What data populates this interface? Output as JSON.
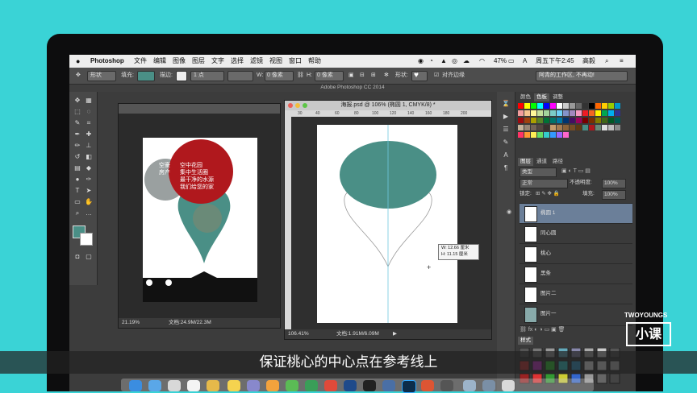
{
  "menubar": {
    "app": "Photoshop",
    "items": [
      "文件",
      "编辑",
      "图像",
      "图层",
      "文字",
      "选择",
      "滤镜",
      "视图",
      "窗口",
      "帮助"
    ],
    "battery": "47%",
    "clock": "周五下午2:45",
    "user": "高毅"
  },
  "window": {
    "title": "Adobe Photoshop CC 2014"
  },
  "options": {
    "mode": "形状",
    "fill_label": "填充:",
    "stroke_label": "描边:",
    "stroke_width": "1 点",
    "w_label": "W:",
    "w_value": "0 像素",
    "h_label": "H:",
    "h_value": "0 像素",
    "shape_label": "形状:",
    "align_edges": "对齐边缘",
    "workspace": "阿青的工作区, 不再动!",
    "colors": {
      "fill": "#4a8f86"
    }
  },
  "doc_left": {
    "title": "",
    "zoom": "21.19%",
    "size": "文档:24.9M/22.3M",
    "poster": {
      "line1a": "空豪",
      "line1b": "空中花园",
      "line2a": "房产",
      "line2b": "集中生活圈",
      "line3": "最干净的水源",
      "line4": "我们给您的家"
    }
  },
  "doc_main": {
    "title": "海报.psd @ 106% (椭圆 1, CMYK/8) *",
    "zoom": "106.41%",
    "size": "文档:1.91M/6.09M",
    "tooltip_w": "W: 12.66 厘米",
    "tooltip_h": "H: 11.15 厘米",
    "ruler": [
      "30",
      "40",
      "60",
      "80",
      "100",
      "120",
      "140",
      "160",
      "180",
      "200"
    ],
    "colors": {
      "ellipse": "#4a8f86"
    }
  },
  "panels": {
    "swatches_tabs": [
      "颜色",
      "色板",
      "调整"
    ],
    "layers_tabs": [
      "图层",
      "通道",
      "路径"
    ],
    "kind": "类型",
    "blend": "正常",
    "opacity_label": "不透明度:",
    "opacity": "100%",
    "lock_label": "锁定:",
    "fill_label": "填充:",
    "fill": "100%",
    "layers": [
      "椭圆 1",
      "同心圆",
      "桃心",
      "黑条",
      "图片二",
      "图片一"
    ],
    "styles_tab": "样式"
  },
  "subtitle": "保证桃心的中心点在参考线上",
  "watermark": {
    "brand": "TWOYOUNGS",
    "logo": "小课"
  }
}
